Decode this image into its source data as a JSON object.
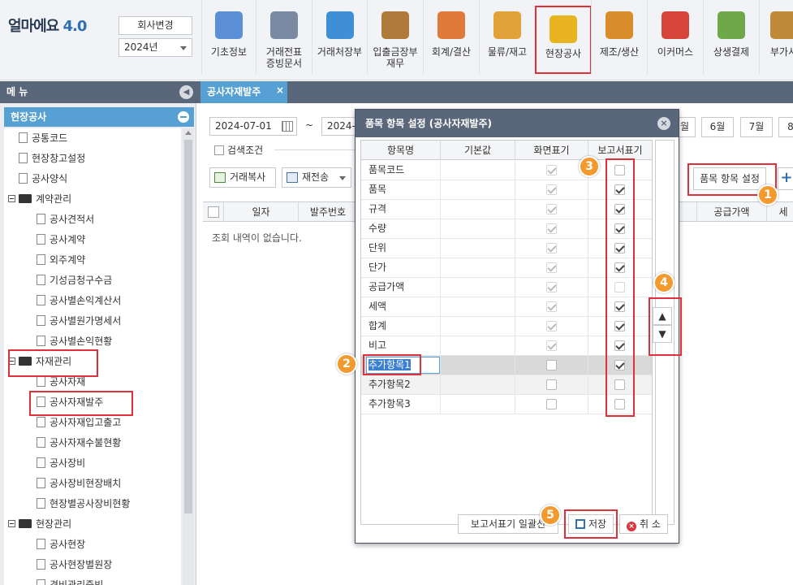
{
  "app": {
    "logo_text": "얼마에요",
    "version": "4.0"
  },
  "header": {
    "company_button": "회사변경",
    "year_value": "2024년",
    "modules": [
      {
        "label": "기초정보",
        "color": "#5b8fd6"
      },
      {
        "label": "거래전표\n증빙문서",
        "color": "#7a8aa3"
      },
      {
        "label": "거래처장부",
        "color": "#3f8fd6"
      },
      {
        "label": "입출금장부\n재무",
        "color": "#b07a3c"
      },
      {
        "label": "회계/결산",
        "color": "#e07a3a"
      },
      {
        "label": "물류/재고",
        "color": "#e2a23a"
      },
      {
        "label": "현장공사",
        "color": "#e8b520"
      },
      {
        "label": "제조/생산",
        "color": "#d98c2a"
      },
      {
        "label": "이커머스",
        "color": "#d6453a"
      },
      {
        "label": "상생결제",
        "color": "#6fa84a"
      },
      {
        "label": "부가서",
        "color": "#c08a3a"
      }
    ],
    "active_module": "현장공사"
  },
  "tabbar": {
    "menu_title": "메 뉴",
    "active_tab": "공사자재발주",
    "close_glyph": "×"
  },
  "sidebar": {
    "section": "현장공사",
    "items": [
      {
        "label": "공통코드",
        "type": "doc",
        "level": 1
      },
      {
        "label": "현장창고설정",
        "type": "doc",
        "level": 1
      },
      {
        "label": "공사양식",
        "type": "doc",
        "level": 1
      },
      {
        "label": "계약관리",
        "type": "folder",
        "level": 0
      },
      {
        "label": "공사견적서",
        "type": "doc",
        "level": 2
      },
      {
        "label": "공사계약",
        "type": "doc",
        "level": 2
      },
      {
        "label": "외주계약",
        "type": "doc",
        "level": 2
      },
      {
        "label": "기성금청구수금",
        "type": "doc",
        "level": 2
      },
      {
        "label": "공사별손익계산서",
        "type": "doc",
        "level": 2
      },
      {
        "label": "공사별원가명세서",
        "type": "doc",
        "level": 2
      },
      {
        "label": "공사별손익현황",
        "type": "doc",
        "level": 2
      },
      {
        "label": "자재관리",
        "type": "folder",
        "level": 0
      },
      {
        "label": "공사자재",
        "type": "doc",
        "level": 2
      },
      {
        "label": "공사자재발주",
        "type": "doc",
        "level": 2
      },
      {
        "label": "공사자재입고출고",
        "type": "doc",
        "level": 2
      },
      {
        "label": "공사자재수불현황",
        "type": "doc",
        "level": 2
      },
      {
        "label": "공사장비",
        "type": "doc",
        "level": 2
      },
      {
        "label": "공사장비현장배치",
        "type": "doc",
        "level": 2
      },
      {
        "label": "현장별공사장비현황",
        "type": "doc",
        "level": 2
      },
      {
        "label": "현장관리",
        "type": "folder",
        "level": 0
      },
      {
        "label": "공사현장",
        "type": "doc",
        "level": 2
      },
      {
        "label": "공사현장별원장",
        "type": "doc",
        "level": 2
      },
      {
        "label": "경비관리증빙",
        "type": "doc",
        "level": 2
      }
    ]
  },
  "main": {
    "date_from": "2024-07-01",
    "date_sep": "~",
    "date_to": "2024-0",
    "month_buttons": [
      "월",
      "6월",
      "7월",
      "8"
    ],
    "search_condition": "검색조건",
    "copy_button": "거래복사",
    "resend_button": "재전송",
    "item_setting_button": "품목 항목 설정",
    "plus_button": "+",
    "columns": [
      "일자",
      "발주번호",
      "공급가액",
      "세"
    ],
    "empty_message": "조회 내역이 없습니다."
  },
  "dialog": {
    "title": "품목 항목 설정 (공사자재발주)",
    "close_glyph": "×",
    "headers": [
      "항목명",
      "기본값",
      "화면표기",
      "보고서표기"
    ],
    "rows": [
      {
        "name": "품목코드",
        "screen": true,
        "screen_enabled": false,
        "report": false
      },
      {
        "name": "품목",
        "screen": true,
        "screen_enabled": false,
        "report": true
      },
      {
        "name": "규격",
        "screen": true,
        "screen_enabled": false,
        "report": true
      },
      {
        "name": "수량",
        "screen": true,
        "screen_enabled": false,
        "report": true
      },
      {
        "name": "단위",
        "screen": true,
        "screen_enabled": false,
        "report": true
      },
      {
        "name": "단가",
        "screen": true,
        "screen_enabled": false,
        "report": true
      },
      {
        "name": "공급가액",
        "screen": true,
        "screen_enabled": false,
        "report": false
      },
      {
        "name": "세액",
        "screen": true,
        "screen_enabled": false,
        "report": true
      },
      {
        "name": "합계",
        "screen": true,
        "screen_enabled": false,
        "report": true
      },
      {
        "name": "비고",
        "screen": true,
        "screen_enabled": false,
        "report": true
      },
      {
        "name": "추가항목1",
        "screen": false,
        "screen_enabled": true,
        "report": true
      },
      {
        "name": "추가항목2",
        "screen": false,
        "screen_enabled": true,
        "report": false
      },
      {
        "name": "추가항목3",
        "screen": false,
        "screen_enabled": true,
        "report": false
      }
    ],
    "editing_value": "추가항목1",
    "move_up": "▲",
    "move_down": "▼",
    "report_all_button": "보고서표기 일괄선",
    "save_button": "저장",
    "cancel_button": "취 소",
    "cancel_glyph": "×"
  },
  "annotations": {
    "badges": [
      "1",
      "2",
      "3",
      "4",
      "5"
    ],
    "color": "#f29a2e",
    "highlight_color": "#e0313a"
  }
}
